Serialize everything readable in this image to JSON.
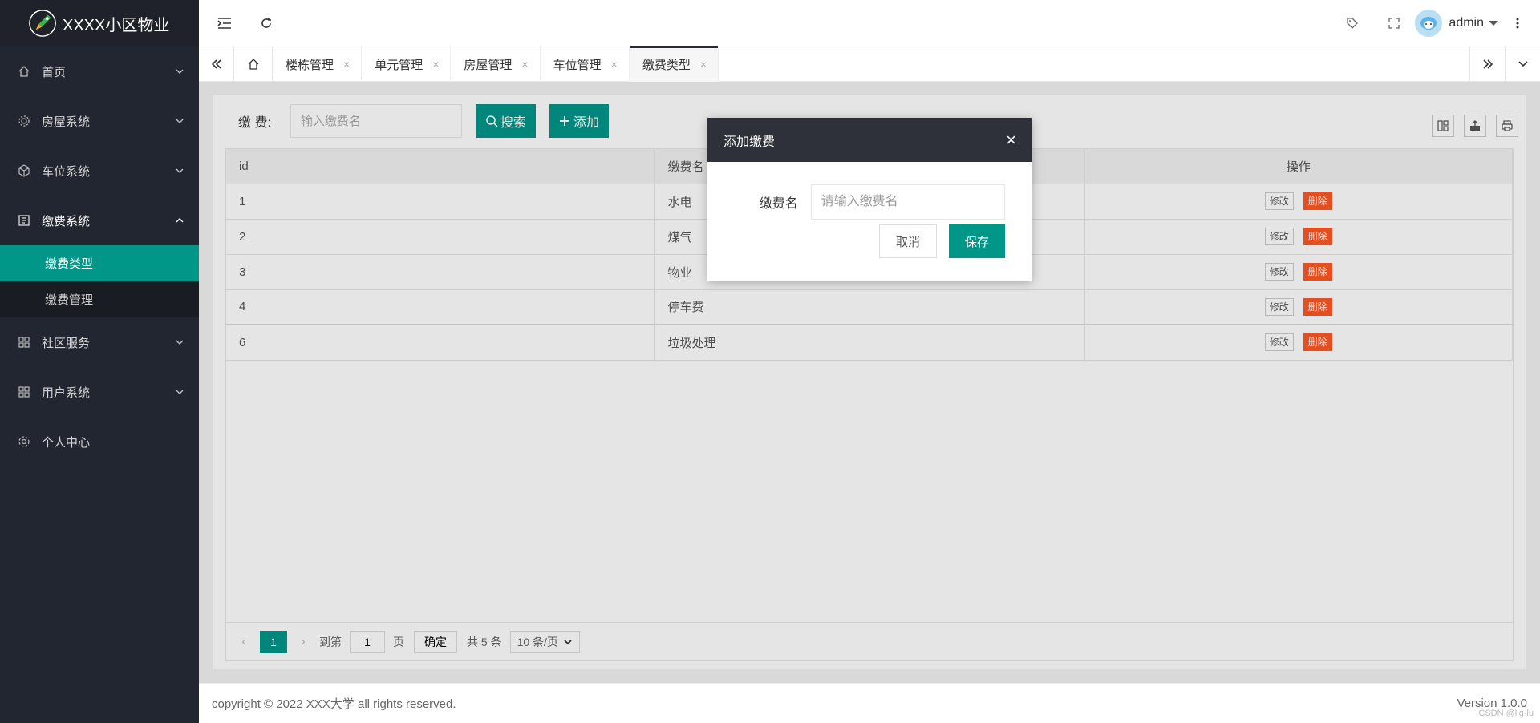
{
  "app": {
    "title": "XXXX小区物业"
  },
  "sidebar": {
    "items": [
      {
        "label": "首页",
        "icon": "home-icon"
      },
      {
        "label": "房屋系统",
        "icon": "gear-icon"
      },
      {
        "label": "车位系统",
        "icon": "cube-icon"
      },
      {
        "label": "缴费系统",
        "icon": "book-icon",
        "children": [
          {
            "label": "缴费类型"
          },
          {
            "label": "缴费管理"
          }
        ]
      },
      {
        "label": "社区服务",
        "icon": "apps-icon"
      },
      {
        "label": "用户系统",
        "icon": "apps-icon"
      },
      {
        "label": "个人中心",
        "icon": "settings-icon"
      }
    ]
  },
  "header": {
    "user": "admin"
  },
  "tabs": [
    {
      "label": "楼栋管理"
    },
    {
      "label": "单元管理"
    },
    {
      "label": "房屋管理"
    },
    {
      "label": "车位管理"
    },
    {
      "label": "缴费类型"
    }
  ],
  "search": {
    "label": "缴 费:",
    "placeholder": "输入缴费名",
    "search_label": "搜索",
    "add_label": "添加"
  },
  "table": {
    "columns": [
      "id",
      "缴费名",
      "操作"
    ],
    "rows": [
      {
        "id": "1",
        "name": "水电"
      },
      {
        "id": "2",
        "name": "煤气"
      },
      {
        "id": "3",
        "name": "物业"
      },
      {
        "id": "4",
        "name": "停车费"
      },
      {
        "id": "6",
        "name": "垃圾处理"
      }
    ],
    "edit_label": "修改",
    "delete_label": "删除"
  },
  "pager": {
    "current": "1",
    "goto_label": "到第",
    "page_input": "1",
    "page_label": "页",
    "ok_label": "确定",
    "total_label": "共 5 条",
    "size_label": "10 条/页"
  },
  "footer": {
    "copyright": "copyright © 2022 XXX大学 all rights reserved.",
    "version": "Version 1.0.0"
  },
  "modal": {
    "title": "添加缴费",
    "field_label": "缴费名",
    "field_placeholder": "请输入缴费名",
    "cancel_label": "取消",
    "save_label": "保存"
  },
  "watermark": "CSDN @lig-lu",
  "colors": {
    "primary": "#009688",
    "sidebar_bg": "#222631",
    "danger": "#ff5722",
    "modal_header": "#2f313a"
  }
}
